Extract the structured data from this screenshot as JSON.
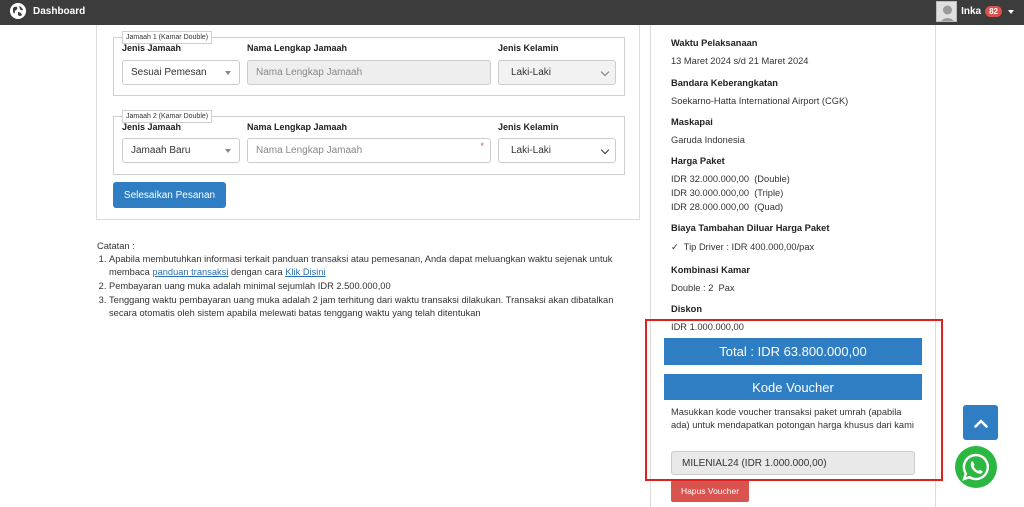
{
  "topbar": {
    "title": "Dashboard",
    "user_name": "Inka",
    "notif_count": "82"
  },
  "form": {
    "jamaah": [
      {
        "legend": "Jamaah 1 (Kamar Double)",
        "label_jenis": "Jenis Jamaah",
        "label_nama": "Nama Lengkap Jamaah",
        "label_kelamin": "Jenis Kelamin",
        "jenis_value": "Sesuai Pemesan",
        "nama_placeholder": "Nama Lengkap Jamaah",
        "kelamin_value": "Laki-Laki"
      },
      {
        "legend": "Jamaah 2 (Kamar Double)",
        "label_jenis": "Jenis Jamaah",
        "label_nama": "Nama Lengkap Jamaah",
        "label_kelamin": "Jenis Kelamin",
        "jenis_value": "Jamaah Baru",
        "nama_placeholder": "Nama Lengkap Jamaah",
        "required_mark": "*",
        "kelamin_value": "Laki-Laki"
      }
    ],
    "submit_label": "Selesaikan Pesanan"
  },
  "notes": {
    "title": "Catatan :",
    "item1_text": "Apabila membutuhkan informasi terkait panduan transaksi atau pemesanan, Anda dapat meluangkan waktu sejenak untuk membaca ",
    "item1_link1": "panduan transaksi",
    "item1_mid": " dengan cara ",
    "item1_link2": "Klik Disini",
    "item2": "Pembayaran uang muka adalah minimal sejumlah IDR 2.500.000,00",
    "item3": "Tenggang waktu pembayaran uang muka adalah 2 jam terhitung dari waktu transaksi dilakukan. Transaksi akan dibatalkan secara otomatis oleh sistem apabila melewati batas tenggang waktu yang telah ditentukan"
  },
  "summary": {
    "waktu_label": "Waktu Pelaksanaan",
    "waktu_value": "13 Maret 2024 s/d 21 Maret 2024",
    "bandara_label": "Bandara Keberangkatan",
    "bandara_value": "Soekarno-Hatta International Airport (CGK)",
    "maskapai_label": "Maskapai",
    "maskapai_value": "Garuda Indonesia",
    "harga_label": "Harga Paket",
    "harga_double": "IDR 32.000.000,00  (Double)",
    "harga_triple": "IDR 30.000.000,00  (Triple)",
    "harga_quad": "IDR 28.000.000,00  (Quad)",
    "biaya_label": "Biaya Tambahan Diluar Harga Paket",
    "biaya_value": "✓  Tip Driver : IDR 400.000,00/pax",
    "kombinasi_label": "Kombinasi Kamar",
    "kombinasi_value": "Double : 2  Pax",
    "diskon_label": "Diskon",
    "diskon_value": "IDR 1.000.000,00",
    "total_label": "Total : IDR 63.800.000,00",
    "voucher_title": "Kode Voucher",
    "voucher_desc": "Masukkan kode voucher transaksi paket umrah (apabila ada) untuk mendapatkan potongan harga khusus dari kami",
    "voucher_value": "MILENIAL24 (IDR 1.000.000,00)",
    "hapus_label": "Hapus Voucher"
  },
  "colors": {
    "primary": "#2f7ec4",
    "danger": "#d9534f",
    "topbar": "#3c3c3c",
    "highlight": "#e02020",
    "whatsapp": "#2bb741"
  },
  "icons": {
    "brand": "globe-icon",
    "scroll": "chevron-up-icon",
    "chat": "whatsapp-icon",
    "avatar": "avatar"
  }
}
